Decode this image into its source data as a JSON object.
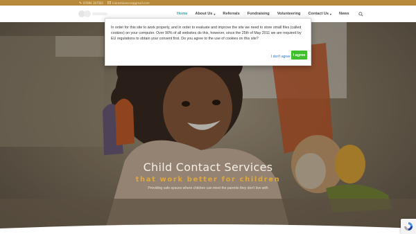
{
  "topbar": {
    "phone": "07894 307581",
    "email": "kiarastiasecxz@gmail.com",
    "color": "#b98a3a"
  },
  "nav": {
    "items": [
      {
        "label": "Home",
        "active": true,
        "dropdown": false
      },
      {
        "label": "About Us",
        "active": false,
        "dropdown": true
      },
      {
        "label": "Referrals",
        "active": false,
        "dropdown": false
      },
      {
        "label": "Fundraising",
        "active": false,
        "dropdown": false
      },
      {
        "label": "Volunteering",
        "active": false,
        "dropdown": false
      },
      {
        "label": "Contact Us",
        "active": false,
        "dropdown": true
      },
      {
        "label": "News",
        "active": false,
        "dropdown": false
      }
    ],
    "search_icon": "search-icon"
  },
  "hero": {
    "title": "Child Contact Services",
    "subtitle": "that work better for children",
    "description": "Providing safe spaces where children can meet the parents they don't live with"
  },
  "cookie": {
    "message": "In order for this site to work properly, and in order to evaluate and improve the site we need to store small files (called cookies) on your computer. Over 90% of all websites do this, however, since the 25th of May 2011 we are required by EU regulations to obtain your consent first. Do you agree to the use of cookies on this site?",
    "decline_label": "I don't agree",
    "accept_label": "I agree",
    "accept_color": "#3fbf2b"
  }
}
